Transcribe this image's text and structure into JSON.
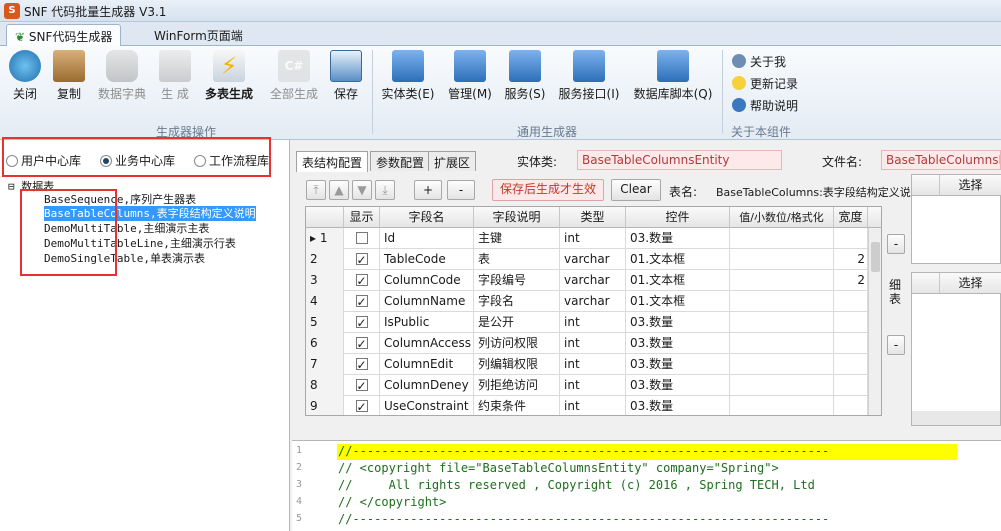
{
  "window": {
    "title": "SNF 代码批量生成器 V3.1",
    "logo": "S"
  },
  "main_tabs": [
    {
      "label": "SNF代码生成器",
      "active": true
    },
    {
      "label": "WinForm页面端",
      "active": false
    }
  ],
  "ribbon": {
    "group1": {
      "label": "生成器操作",
      "buttons": [
        {
          "label": "关闭",
          "icon": "power-icon"
        },
        {
          "label": "复制",
          "icon": "copy-icon"
        },
        {
          "label": "数据字典",
          "icon": "database-icon",
          "disabled": true
        },
        {
          "label": "生 成",
          "icon": "generate-icon",
          "disabled": true
        },
        {
          "label": "多表生成",
          "icon": "lightning-icon",
          "bold": true
        },
        {
          "label": "全部生成",
          "icon": "csharp-icon",
          "disabled": true
        },
        {
          "label": "保存",
          "icon": "save-icon"
        }
      ]
    },
    "group2": {
      "label": "通用生成器",
      "buttons": [
        {
          "label": "实体类(E)",
          "icon": "entity-icon"
        },
        {
          "label": "管理(M)",
          "icon": "manage-icon"
        },
        {
          "label": "服务(S)",
          "icon": "service-icon"
        },
        {
          "label": "服务接口(I)",
          "icon": "interface-icon"
        },
        {
          "label": "数据库脚本(Q)",
          "icon": "dbscript-icon"
        }
      ]
    },
    "group3": {
      "label": "关于本组件",
      "buttons": [
        {
          "label": "关于我",
          "icon": "gears-icon"
        },
        {
          "label": "更新记录",
          "icon": "bulb-icon"
        },
        {
          "label": "帮助说明",
          "icon": "help-icon"
        }
      ]
    }
  },
  "left": {
    "radios": [
      {
        "label": "用户中心库",
        "on": false
      },
      {
        "label": "业务中心库",
        "on": true
      },
      {
        "label": "工作流程库",
        "on": false
      }
    ],
    "tree_root": "数据表",
    "tree_items": [
      "BaseSequence,序列产生器表",
      "BaseTableColumns,表字段结构定义说明",
      "DemoMultiTable,主细演示主表",
      "DemoMultiTableLine,主细演示行表",
      "DemoSingleTable,单表演示表"
    ],
    "selected_index": 1
  },
  "right": {
    "sub_tabs": [
      "表结构配置",
      "参数配置",
      "扩展区"
    ],
    "entity_label": "实体类:",
    "entity_value": "BaseTableColumnsEntity",
    "file_label": "文件名:",
    "file_value": "BaseTableColumnsEntity.cs",
    "toolbar": {
      "plus": "+",
      "minus": "-",
      "save_regen": "保存后生成才生效",
      "clear": "Clear",
      "table_label": "表名:",
      "table_value": "BaseTableColumns:表字段结构定义说明"
    },
    "grid": {
      "headers": [
        "显示",
        "字段名",
        "字段说明",
        "类型",
        "控件",
        "值/小数位/格式化",
        "宽度"
      ],
      "rows": [
        {
          "num": "1",
          "show": false,
          "field": "Id",
          "desc": "主键",
          "type": "int",
          "ctrl": "03.数量",
          "fmt": "",
          "width": ""
        },
        {
          "num": "2",
          "show": true,
          "field": "TableCode",
          "desc": "表",
          "type": "varchar",
          "ctrl": "01.文本框",
          "fmt": "",
          "width": "2"
        },
        {
          "num": "3",
          "show": true,
          "field": "ColumnCode",
          "desc": "字段编号",
          "type": "varchar",
          "ctrl": "01.文本框",
          "fmt": "",
          "width": "2"
        },
        {
          "num": "4",
          "show": true,
          "field": "ColumnName",
          "desc": "字段名",
          "type": "varchar",
          "ctrl": "01.文本框",
          "fmt": "",
          "width": ""
        },
        {
          "num": "5",
          "show": true,
          "field": "IsPublic",
          "desc": "是公开",
          "type": "int",
          "ctrl": "03.数量",
          "fmt": "",
          "width": ""
        },
        {
          "num": "6",
          "show": true,
          "field": "ColumnAccess",
          "desc": "列访问权限",
          "type": "int",
          "ctrl": "03.数量",
          "fmt": "",
          "width": ""
        },
        {
          "num": "7",
          "show": true,
          "field": "ColumnEdit",
          "desc": "列编辑权限",
          "type": "int",
          "ctrl": "03.数量",
          "fmt": "",
          "width": ""
        },
        {
          "num": "8",
          "show": true,
          "field": "ColumnDeney",
          "desc": "列拒绝访问",
          "type": "int",
          "ctrl": "03.数量",
          "fmt": "",
          "width": ""
        },
        {
          "num": "9",
          "show": true,
          "field": "UseConstraint",
          "desc": "约束条件",
          "type": "int",
          "ctrl": "03.数量",
          "fmt": "",
          "width": ""
        }
      ]
    },
    "side": {
      "col_header": "选择",
      "detail_label": "细\n表",
      "minus": "-"
    },
    "code_lines": [
      {
        "n": "1",
        "text": "//------------------------------------------------------------------"
      },
      {
        "n": "2",
        "text": "// <copyright file=\"BaseTableColumnsEntity\" company=\"Spring\">"
      },
      {
        "n": "3",
        "text": "//     All rights reserved , Copyright (c) 2016 , Spring TECH, Ltd"
      },
      {
        "n": "4",
        "text": "// </copyright>"
      },
      {
        "n": "5",
        "text": "//------------------------------------------------------------------"
      }
    ]
  }
}
